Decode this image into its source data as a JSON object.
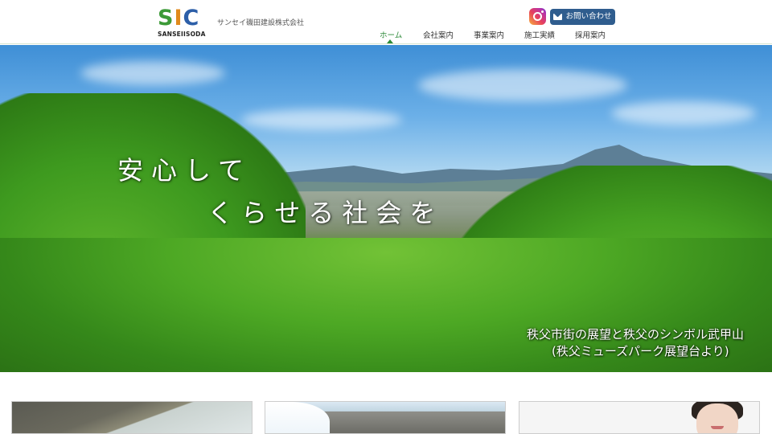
{
  "header": {
    "logo_main": "SIC",
    "logo_sub": "SANSEIISODA",
    "company_name": "サンセイ磯田建設株式会社",
    "contact_label": "お問い合わせ",
    "nav": [
      {
        "label": "ホーム",
        "active": true
      },
      {
        "label": "会社案内",
        "active": false
      },
      {
        "label": "事業案内",
        "active": false
      },
      {
        "label": "施工実績",
        "active": false
      },
      {
        "label": "採用案内",
        "active": false
      }
    ]
  },
  "hero": {
    "headline_line1": "安心して",
    "headline_line2": "くらせる社会を",
    "caption_line1": "秩父市街の展望と秩父のシンボル武甲山",
    "caption_line2": "(秩父ミューズパーク展望台より)"
  },
  "colors": {
    "accent_green": "#2e8b3a",
    "contact_blue": "#2f5d8e",
    "logo_green": "#3c9a37",
    "logo_orange": "#e08a1c",
    "logo_blue": "#2d5fa8"
  },
  "icons": [
    "instagram-icon",
    "mail-icon"
  ]
}
